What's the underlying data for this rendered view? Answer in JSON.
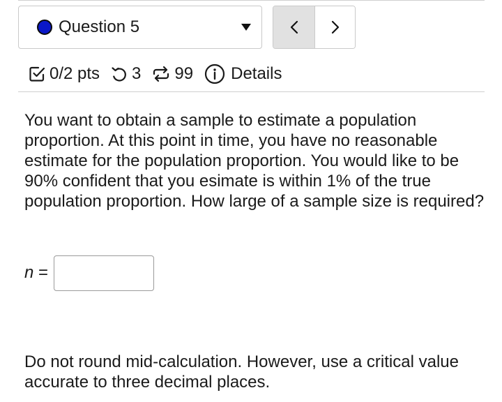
{
  "question_nav": {
    "current_label": "Question 5",
    "status_color": "#0a18c8",
    "prev_icon": "chevron-left-icon",
    "next_icon": "chevron-right-icon"
  },
  "meta": {
    "points": "0/2 pts",
    "retries": "3",
    "attempts": "99",
    "details_label": "Details"
  },
  "question": {
    "text": "You want to obtain a sample to estimate a population proportion. At this point in time, you have no reasonable estimate for the population proportion. You would like to be 90% confident that you esimate is within 1% of the true population proportion. How large of a sample size is required?",
    "answer_variable": "n",
    "answer_equals": " =",
    "answer_value": "",
    "note": "Do not round mid-calculation. However, use a critical value accurate to three decimal places."
  }
}
